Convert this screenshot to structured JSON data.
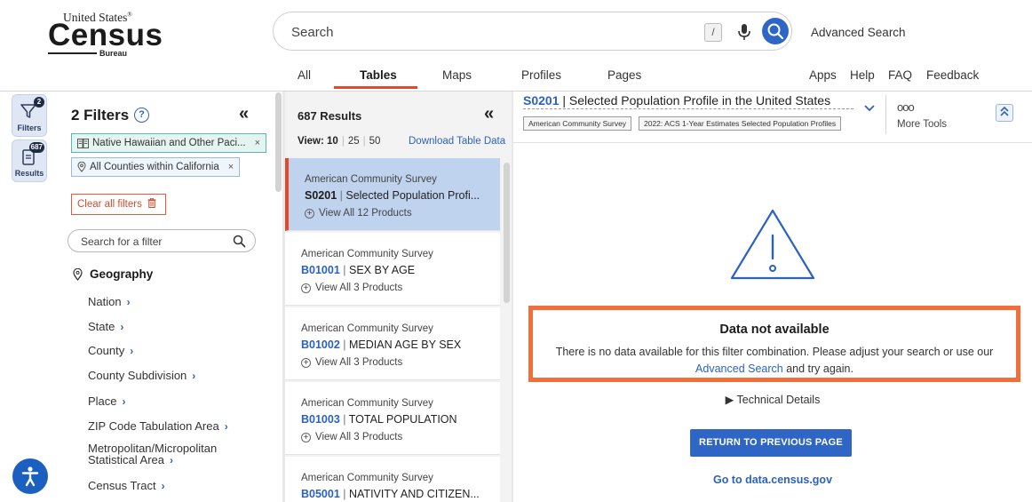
{
  "logo": {
    "line1": "United States",
    "reg": "®",
    "line2": "Census",
    "line3": "Bureau"
  },
  "search": {
    "placeholder": "Search",
    "shortcut": "/",
    "advanced": "Advanced Search"
  },
  "nav": {
    "tabs": [
      {
        "label": "All"
      },
      {
        "label": "Tables"
      },
      {
        "label": "Maps"
      },
      {
        "label": "Profiles"
      },
      {
        "label": "Pages"
      }
    ],
    "active_tab": "Tables",
    "links": [
      "Apps",
      "Help",
      "FAQ",
      "Feedback"
    ]
  },
  "rail": {
    "filters": {
      "label": "Filters",
      "badge": "2"
    },
    "results": {
      "label": "Results",
      "badge": "687"
    }
  },
  "filters": {
    "title": "2 Filters",
    "help": "?",
    "collapse": "«",
    "chips": [
      {
        "label": "Native Hawaiian and Other Paci...",
        "x": "×"
      },
      {
        "label": "All Counties within California",
        "x": "×"
      }
    ],
    "clear_label": "Clear all filters",
    "search_placeholder": "Search for a filter",
    "geography": {
      "heading": "Geography",
      "items": [
        "Nation",
        "State",
        "County",
        "County Subdivision",
        "Place",
        "ZIP Code Tabulation Area",
        "Metropolitan/Micropolitan",
        "Statistical Area",
        "Census Tract"
      ]
    }
  },
  "results": {
    "count": "687 Results",
    "collapse": "«",
    "view_label": "View:",
    "view_options": [
      "10",
      "25",
      "50"
    ],
    "download": "Download Table Data",
    "items": [
      {
        "source": "American Community Survey",
        "code": "S0201",
        "sep": " | ",
        "title": "Selected Population Profi...",
        "products": "View All 12 Products"
      },
      {
        "source": "American Community Survey",
        "code": "B01001",
        "sep": " | ",
        "title": "SEX BY AGE",
        "products": "View All 3 Products"
      },
      {
        "source": "American Community Survey",
        "code": "B01002",
        "sep": " | ",
        "title": "MEDIAN AGE BY SEX",
        "products": "View All 3 Products"
      },
      {
        "source": "American Community Survey",
        "code": "B01003",
        "sep": " | ",
        "title": "TOTAL POPULATION",
        "products": "View All 3 Products"
      },
      {
        "source": "American Community Survey",
        "code": "B05001",
        "sep": " | ",
        "title": "NATIVITY AND CITIZEN...",
        "products": ""
      }
    ]
  },
  "table": {
    "code": "S0201",
    "sep": " | ",
    "title": "Selected Population Profile in the United States",
    "chips": [
      "American Community Survey",
      "2022: ACS 1-Year Estimates Selected Population Profiles"
    ],
    "more_dots": "ooo",
    "more_tools": "More Tools"
  },
  "notice": {
    "heading": "Data not available",
    "line1": "There is no data available for this filter combination. Please adjust your search or use our",
    "link": "Advanced Search",
    "line2_tail": " and try again.",
    "tech": "▶ Technical Details",
    "return_btn": "RETURN TO PREVIOUS PAGE",
    "goto": "Go to data.census.gov"
  },
  "colors": {
    "accent": "#2f66c6",
    "highlight": "#f26f3b",
    "selected_bg": "#bfd3ee"
  }
}
